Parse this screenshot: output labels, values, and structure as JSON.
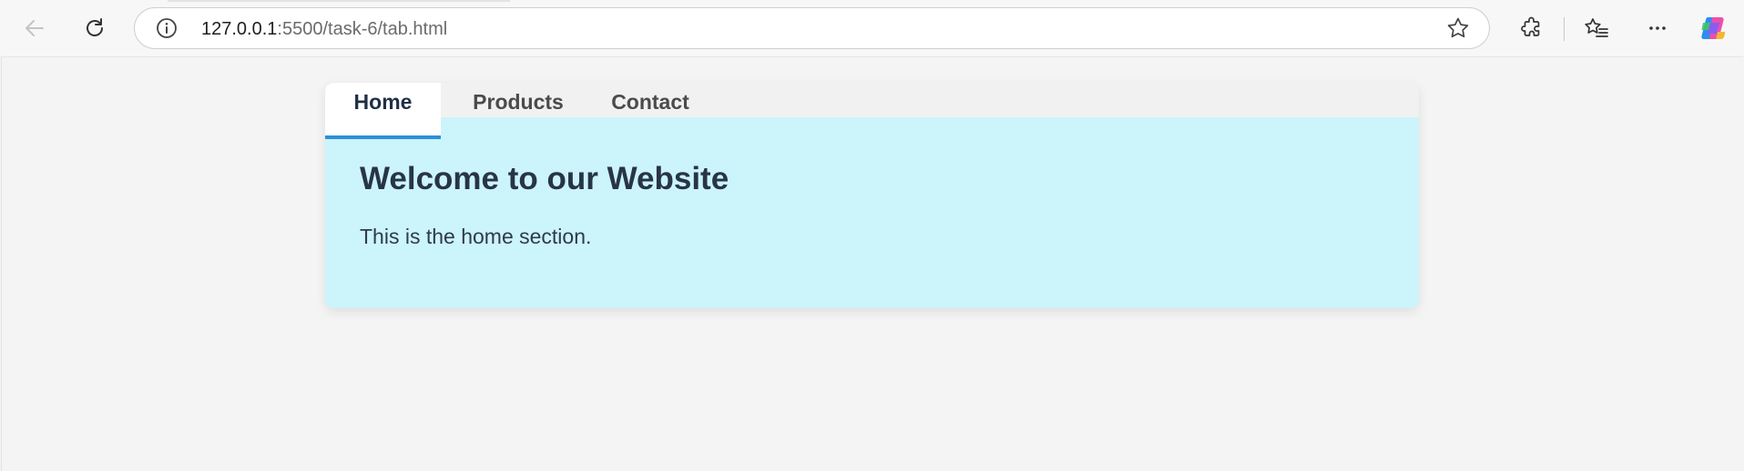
{
  "browser": {
    "url_host": "127.0.0.1",
    "url_path": ":5500/task-6/tab.html"
  },
  "tabs": [
    {
      "label": "Home",
      "active": true
    },
    {
      "label": "Products",
      "active": false
    },
    {
      "label": "Contact",
      "active": false
    }
  ],
  "panel": {
    "heading": "Welcome to our Website",
    "text": "This is the home section."
  },
  "colors": {
    "active_tab_underline": "#2f8fd8",
    "panel_background": "#ccf4fb",
    "heading": "#283447"
  },
  "icons": [
    "back-arrow-icon",
    "refresh-icon",
    "info-icon",
    "star-icon",
    "extensions-icon",
    "favorites-icon",
    "more-icon",
    "copilot-icon"
  ]
}
